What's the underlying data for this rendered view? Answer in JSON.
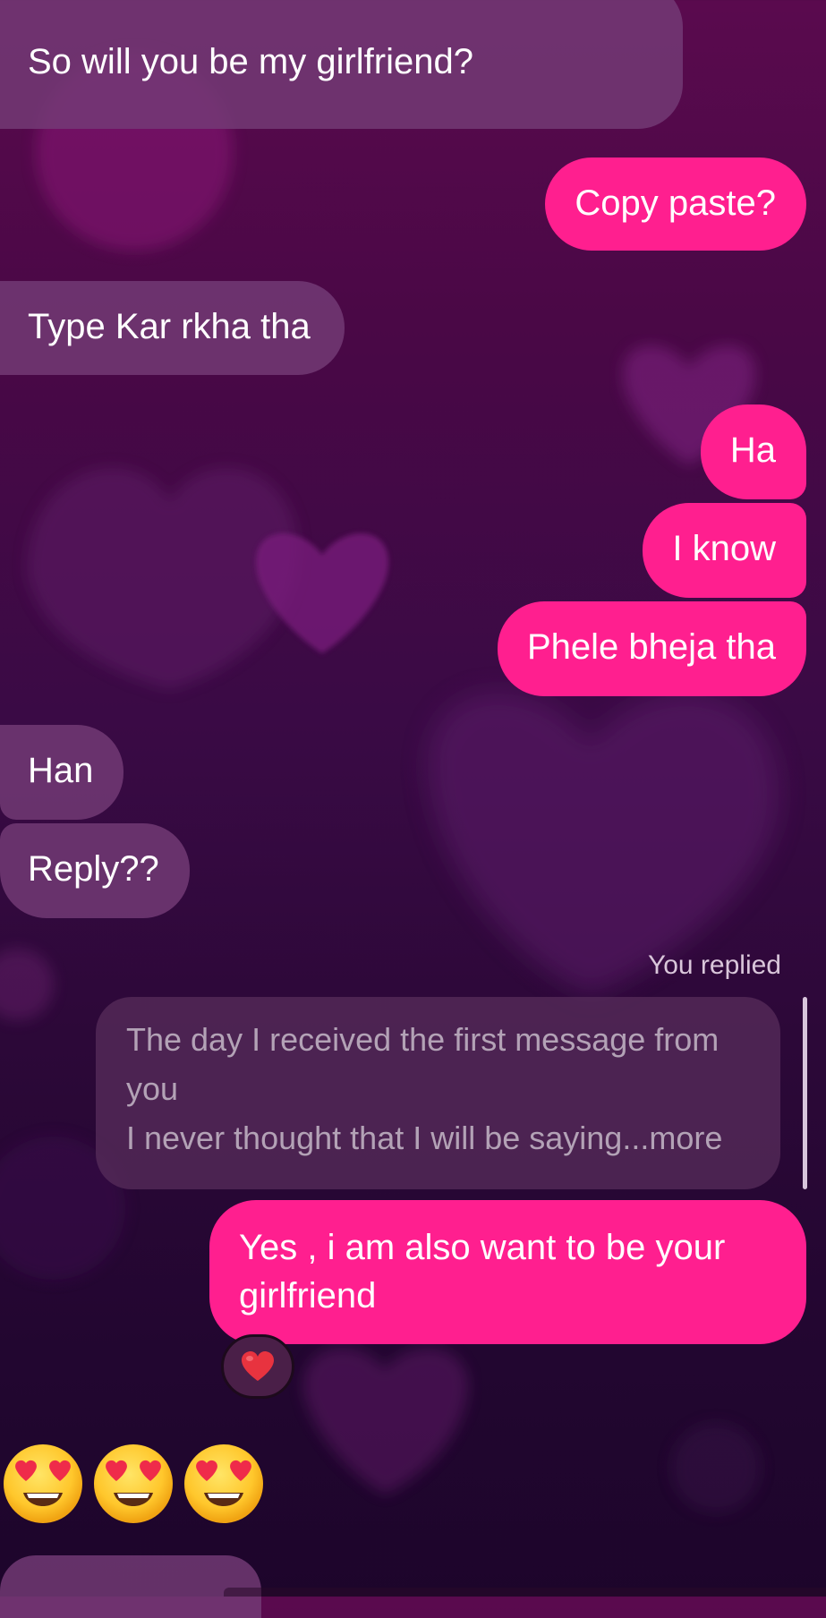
{
  "messages": [
    {
      "side": "received",
      "text": "So will you be my girlfriend?"
    },
    {
      "side": "sent",
      "text": "Copy paste?"
    },
    {
      "side": "received",
      "text": "Type Kar rkha tha"
    },
    {
      "side": "sent",
      "text": "Ha"
    },
    {
      "side": "sent",
      "text": "I know"
    },
    {
      "side": "sent",
      "text": "Phele bheja tha"
    },
    {
      "side": "received",
      "text": "Han"
    },
    {
      "side": "received",
      "text": "Reply??"
    }
  ],
  "reply": {
    "label": "You replied",
    "quoted_lines": [
      "The day I received the first message from",
      "you",
      "I never thought that I will be saying...more"
    ],
    "message_line1": "Yes , i am also want to be your",
    "message_line2": "girlfriend",
    "reaction": "red-heart"
  },
  "emoji_message": [
    "smiling-face-with-heart-eyes",
    "smiling-face-with-heart-eyes",
    "smiling-face-with-heart-eyes"
  ],
  "colors": {
    "sent_bubble": "#ff1f8f",
    "received_bubble": "#743c76",
    "background_top": "#5a0a4e",
    "background_bottom": "#1d052b"
  }
}
